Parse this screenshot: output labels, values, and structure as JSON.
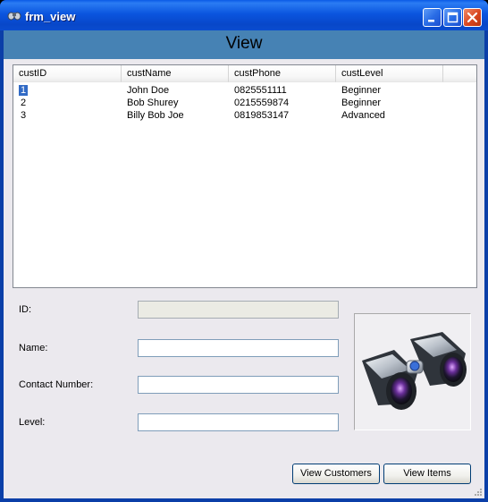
{
  "window": {
    "title": "frm_view",
    "buttons": [
      "minimize",
      "maximize",
      "close"
    ]
  },
  "header": {
    "title": "View",
    "band_color": "#4682b4"
  },
  "list": {
    "columns": [
      "custID",
      "custName",
      "custPhone",
      "custLevel"
    ],
    "rows": [
      {
        "id": "1",
        "name": "John Doe",
        "phone": "0825551111",
        "level": "Beginner"
      },
      {
        "id": "2",
        "name": "Bob Shurey",
        "phone": "0215559874",
        "level": "Beginner"
      },
      {
        "id": "3",
        "name": "Billy Bob Joe",
        "phone": "0819853147",
        "level": "Advanced"
      }
    ],
    "selected_row": 0
  },
  "form": {
    "id_label": "ID:",
    "id_value": "",
    "name_label": "Name:",
    "name_value": "",
    "contact_label": "Contact Number:",
    "contact_value": "",
    "level_label": "Level:",
    "level_value": ""
  },
  "image": {
    "icon": "binoculars-icon"
  },
  "buttons": {
    "view_customers": "View Customers",
    "view_items": "View Items"
  },
  "colors": {
    "titlebar": "#0a55df",
    "selection": "#316ac5",
    "accent": "#4682b4"
  }
}
